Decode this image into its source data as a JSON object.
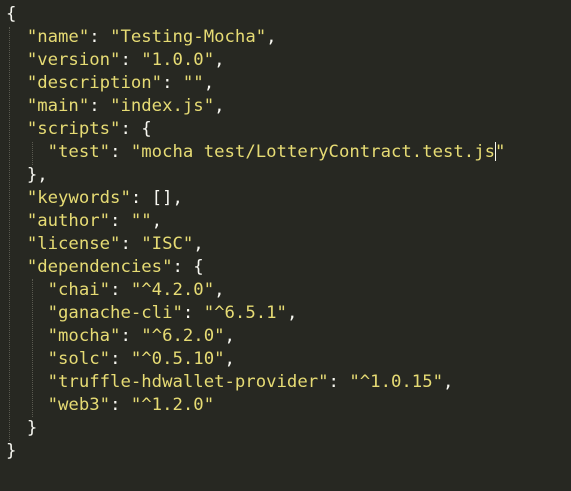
{
  "editor": {
    "cursor_line": 6,
    "cursor_after_text": "mocha test/LotteryContract.test.js"
  },
  "json": {
    "open_brace": "{",
    "name_key": "\"name\"",
    "name_value": "\"Testing-Mocha\"",
    "version_key": "\"version\"",
    "version_value": "\"1.0.0\"",
    "description_key": "\"description\"",
    "description_value": "\"\"",
    "main_key": "\"main\"",
    "main_value": "\"index.js\"",
    "scripts_key": "\"scripts\"",
    "test_key": "\"test\"",
    "test_value_before_cursor": "\"mocha test/LotteryContract.test.js",
    "test_value_after_cursor": "\"",
    "scripts_close": "},",
    "keywords_key": "\"keywords\"",
    "keywords_value": "[]",
    "author_key": "\"author\"",
    "author_value": "\"\"",
    "license_key": "\"license\"",
    "license_value": "\"ISC\"",
    "dependencies_key": "\"dependencies\"",
    "deps": [
      {
        "key": "\"chai\"",
        "value": "\"^4.2.0\"",
        "comma": ","
      },
      {
        "key": "\"ganache-cli\"",
        "value": "\"^6.5.1\"",
        "comma": ","
      },
      {
        "key": "\"mocha\"",
        "value": "\"^6.2.0\"",
        "comma": ","
      },
      {
        "key": "\"solc\"",
        "value": "\"^0.5.10\"",
        "comma": ","
      },
      {
        "key": "\"truffle-hdwallet-provider\"",
        "value": "\"^1.0.15\"",
        "comma": ","
      },
      {
        "key": "\"web3\"",
        "value": "\"^1.2.0\"",
        "comma": ""
      }
    ],
    "dependencies_close": "}",
    "close_brace": "}"
  }
}
